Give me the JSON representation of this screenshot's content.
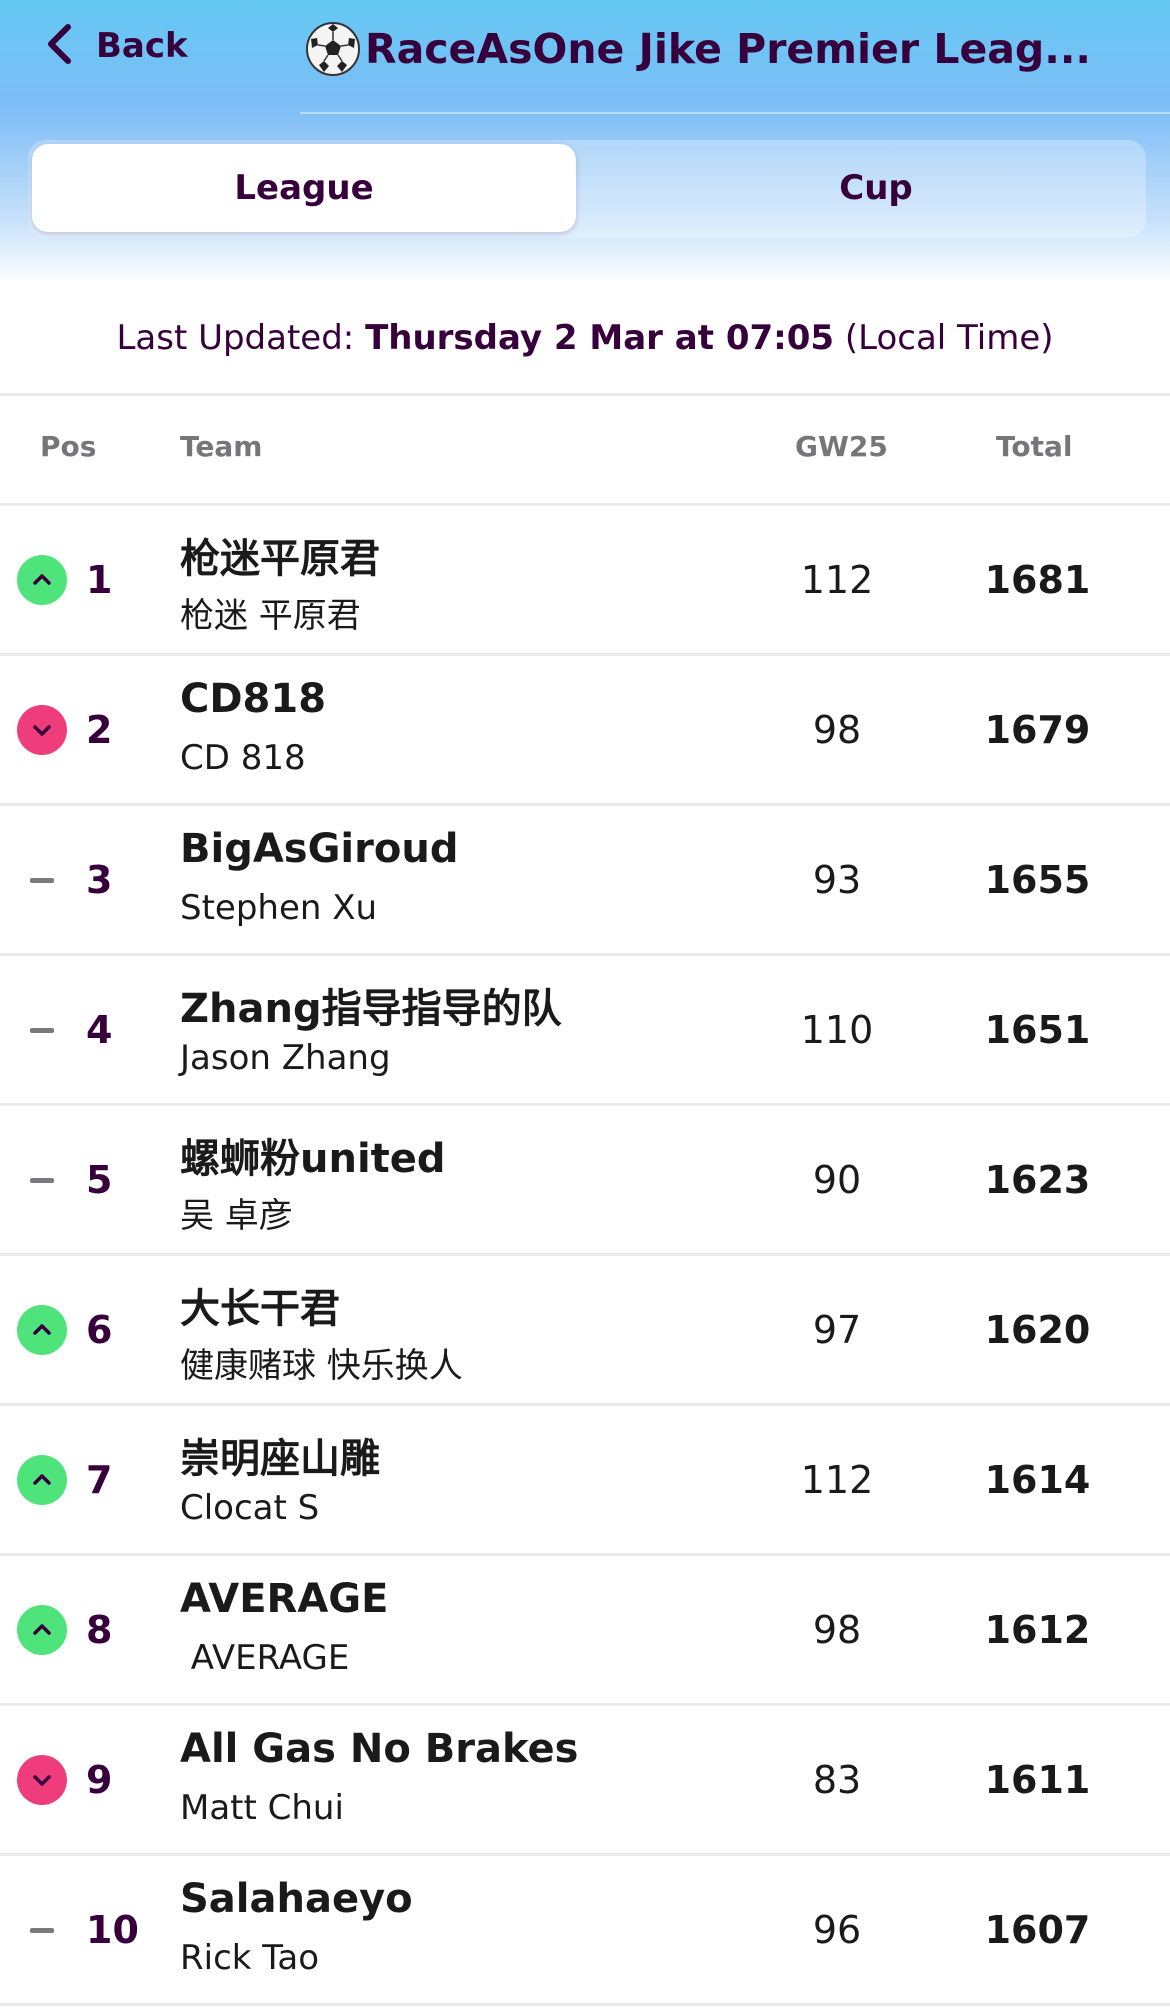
{
  "header": {
    "back_label": "Back",
    "title": "RaceAsOne Jike Premier Leag..."
  },
  "tabs": [
    {
      "label": "League",
      "active": true
    },
    {
      "label": "Cup",
      "active": false
    }
  ],
  "last_updated": {
    "prefix": "Last Updated: ",
    "datetime": "Thursday 2 Mar at 07:05",
    "suffix": " (Local Time)"
  },
  "columns": {
    "pos": "Pos",
    "team": "Team",
    "gw": "GW25",
    "total": "Total"
  },
  "colors": {
    "primary": "#37003c",
    "up": "#4ee37b",
    "down": "#ef3d7b",
    "same": "#7a7a7e",
    "header_gradient_top": "#64c8f3"
  },
  "standings": [
    {
      "rank": "1",
      "movement": "up",
      "team": "枪迷平原君",
      "manager": "枪迷 平原君",
      "gw": "112",
      "total": "1681"
    },
    {
      "rank": "2",
      "movement": "down",
      "team": "CD818",
      "manager": "CD 818",
      "gw": "98",
      "total": "1679"
    },
    {
      "rank": "3",
      "movement": "same",
      "team": "BigAsGiroud",
      "manager": "Stephen Xu",
      "gw": "93",
      "total": "1655"
    },
    {
      "rank": "4",
      "movement": "same",
      "team": "Zhang指导指导的队",
      "manager": "Jason Zhang",
      "gw": "110",
      "total": "1651"
    },
    {
      "rank": "5",
      "movement": "same",
      "team": "螺蛳粉united",
      "manager": "吴 卓彦",
      "gw": "90",
      "total": "1623"
    },
    {
      "rank": "6",
      "movement": "up",
      "team": "大长干君",
      "manager": "健康赌球 快乐换人",
      "gw": "97",
      "total": "1620"
    },
    {
      "rank": "7",
      "movement": "up",
      "team": "崇明座山雕",
      "manager": "Clocat S",
      "gw": "112",
      "total": "1614"
    },
    {
      "rank": "8",
      "movement": "up",
      "team": "AVERAGE",
      "manager": " AVERAGE",
      "gw": "98",
      "total": "1612"
    },
    {
      "rank": "9",
      "movement": "down",
      "team": "All Gas No Brakes",
      "manager": "Matt Chui",
      "gw": "83",
      "total": "1611"
    },
    {
      "rank": "10",
      "movement": "same",
      "team": "Salahaeyo",
      "manager": "Rick Tao",
      "gw": "96",
      "total": "1607"
    }
  ]
}
